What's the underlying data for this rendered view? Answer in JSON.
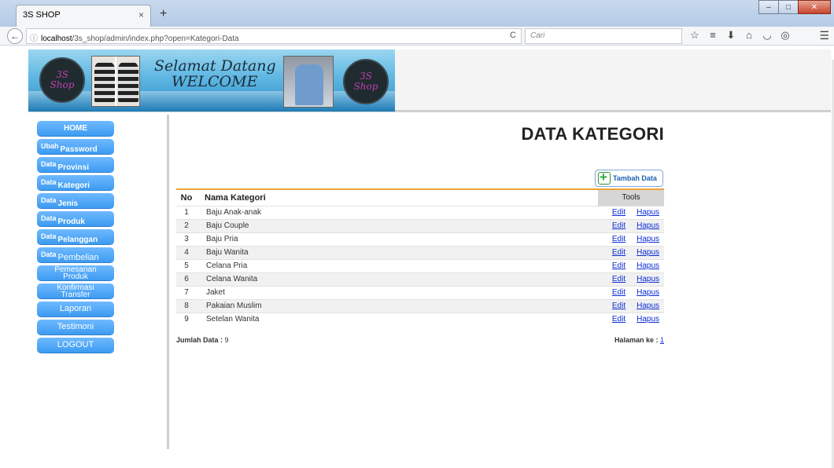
{
  "browser": {
    "tab_title": "3S SHOP",
    "tab_close": "×",
    "new_tab": "+",
    "url_host": "localhost",
    "url_path": "/3s_shop/admin/index.php?open=Kategori-Data",
    "search_placeholder": "Cari",
    "info_icon": "ⓘ",
    "back_icon": "←",
    "reload_icon": "C",
    "search_icon": "🔍"
  },
  "banner": {
    "logo_text_top": "3S",
    "logo_text_bottom": "Shop",
    "welcome_line1": "Selamat Datang",
    "welcome_line2": "WELCOME"
  },
  "sidebar": {
    "items": [
      {
        "label": "HOME"
      },
      {
        "prefix": "Ubah",
        "label": "Password"
      },
      {
        "prefix": "Data",
        "label": "Provinsi"
      },
      {
        "prefix": "Data",
        "label": "Kategori"
      },
      {
        "prefix": "Data",
        "label": "Jenis"
      },
      {
        "prefix": "Data",
        "label": "Produk"
      },
      {
        "prefix": "Data",
        "label": "Pelanggan"
      },
      {
        "prefix": "Data",
        "label": "Pembelian"
      },
      {
        "line1": "Pemesanan",
        "line2": "Produk"
      },
      {
        "line1": "Konfirmasi",
        "line2": "Transfer"
      },
      {
        "label": "Laporan"
      },
      {
        "label": "Testimoni"
      },
      {
        "label": "LOGOUT"
      }
    ]
  },
  "main": {
    "title": "DATA KATEGORI",
    "add_button": "Tambah Data",
    "table": {
      "headers": [
        "No",
        "Nama Kategori",
        "Tools"
      ],
      "rows": [
        {
          "no": "1",
          "name": "Baju Anak-anak"
        },
        {
          "no": "2",
          "name": "Baju Couple"
        },
        {
          "no": "3",
          "name": "Baju Pria"
        },
        {
          "no": "4",
          "name": "Baju Wanita"
        },
        {
          "no": "5",
          "name": "Celana Pria"
        },
        {
          "no": "6",
          "name": "Celana Wanita"
        },
        {
          "no": "7",
          "name": "Jaket"
        },
        {
          "no": "8",
          "name": "Pakaian Muslim"
        },
        {
          "no": "9",
          "name": "Setelan Wanita"
        }
      ],
      "edit_label": "Edit",
      "delete_label": "Hapus"
    },
    "footer": {
      "count_label": "Jumlah Data :",
      "count_value": "9",
      "page_label": "Halaman ke :",
      "page_value": "1"
    }
  }
}
